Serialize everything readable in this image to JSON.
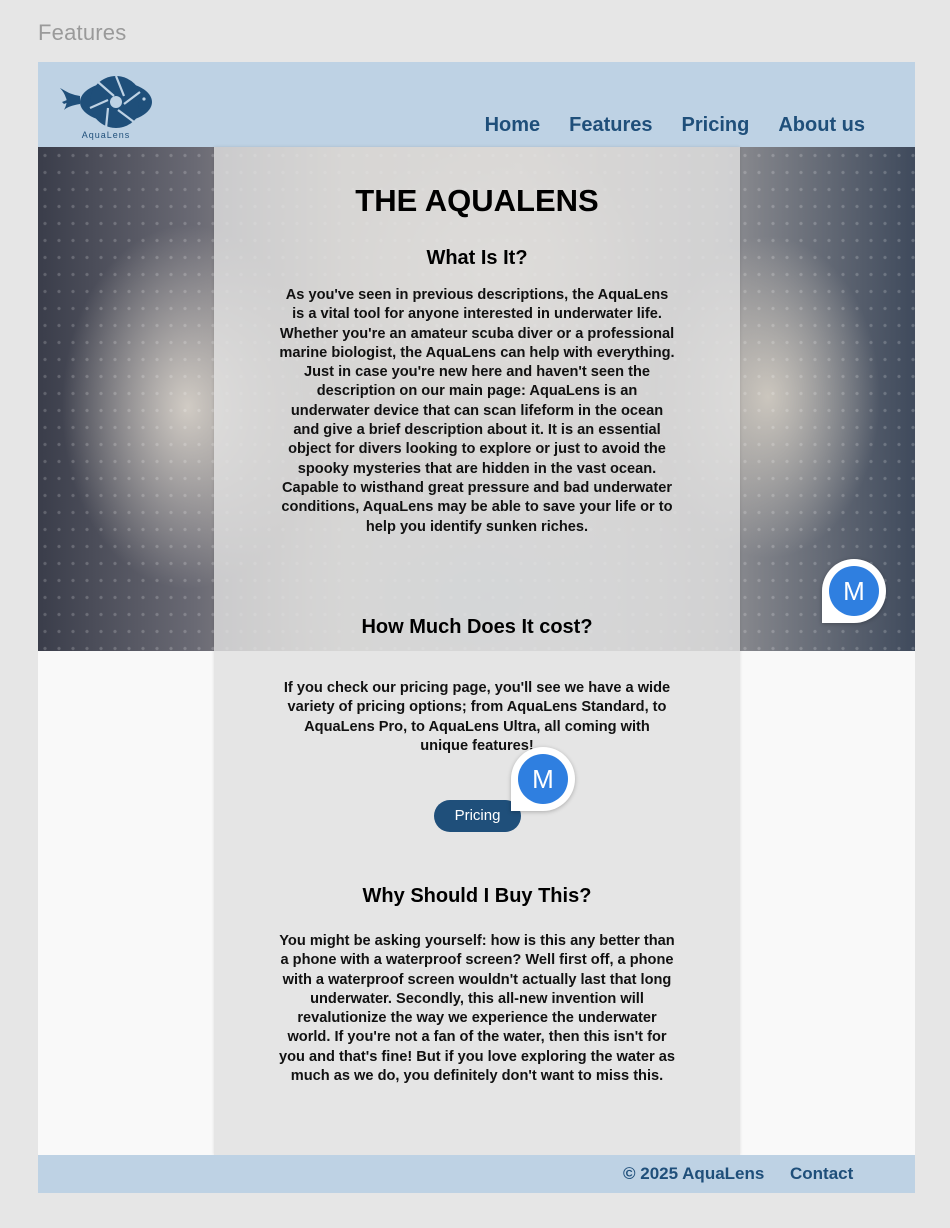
{
  "frame": {
    "label": "Features"
  },
  "header": {
    "logo_text": "AquaLens",
    "nav": [
      {
        "label": "Home"
      },
      {
        "label": "Features"
      },
      {
        "label": "Pricing"
      },
      {
        "label": "About us"
      }
    ]
  },
  "main": {
    "title": "THE AQUALENS",
    "sections": [
      {
        "heading": "What Is It?",
        "body": "As you've seen in previous descriptions, the AquaLens is a vital tool for anyone interested in underwater life. Whether you're an amateur scuba diver or a professional marine biologist, the AquaLens can help with everything. Just in case you're new here and haven't seen the description on our main page: AquaLens is an underwater device that can scan lifeform in the ocean and give a brief description about it. It is an essential object for divers looking to explore or just to avoid the spooky mysteries that are hidden in the vast ocean. Capable to wisthand great pressure and bad underwater conditions, AquaLens may be able to save your life or to help you identify sunken riches."
      },
      {
        "heading": "How Much Does It cost?",
        "body": "If you check our pricing page, you'll see we have a wide variety of pricing options; from AquaLens Standard, to AquaLens Pro, to AquaLens Ultra, all coming with unique features!",
        "button_label": "Pricing"
      },
      {
        "heading": "Why Should I Buy This?",
        "body": "You might be asking yourself: how is this any better than a phone with a waterproof screen? Well first off, a phone with a waterproof screen wouldn't actually last that long underwater. Secondly, this all-new invention will revalutionize the way we experience the underwater world. If you're not a fan of the water, then this isn't for you and that's fine! But if you love exploring the water as much as we do, you definitely don't want to miss this."
      }
    ]
  },
  "comment_markers": [
    {
      "initial": "M"
    },
    {
      "initial": "M"
    }
  ],
  "footer": {
    "copyright": "© 2025 AquaLens",
    "contact": "Contact"
  },
  "colors": {
    "header_bg": "#bed2e4",
    "brand_navy": "#1f4f7a",
    "avatar_blue": "#2f7fe0"
  }
}
